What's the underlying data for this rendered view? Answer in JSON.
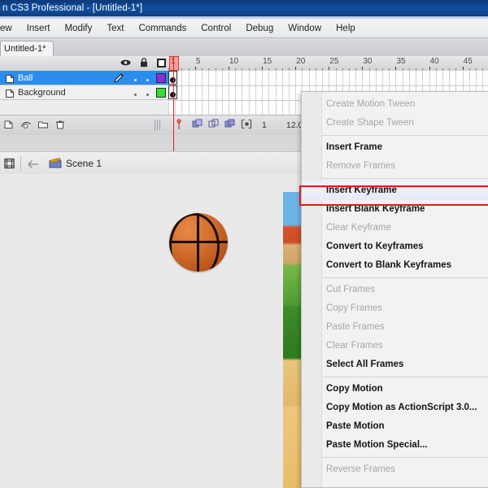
{
  "window": {
    "title": "n CS3 Professional - [Untitled-1*]"
  },
  "menubar": {
    "items": [
      {
        "label": "ew"
      },
      {
        "label": "Insert"
      },
      {
        "label": "Modify"
      },
      {
        "label": "Text"
      },
      {
        "label": "Commands"
      },
      {
        "label": "Control"
      },
      {
        "label": "Debug"
      },
      {
        "label": "Window"
      },
      {
        "label": "Help"
      }
    ]
  },
  "document_tab": {
    "label": "Untitled-1*"
  },
  "timeline": {
    "column_icons": [
      "eye-icon",
      "lock-icon",
      "outline-square-icon"
    ],
    "ruler_ticks": [
      "1",
      "5",
      "10",
      "15",
      "20",
      "25",
      "30",
      "35",
      "40",
      "45"
    ],
    "layers": [
      {
        "name": "Ball",
        "selected": true,
        "status_icon": "pencil-icon",
        "color": "#8a2be2"
      },
      {
        "name": "Background",
        "selected": false,
        "status_icon": "dot-icon",
        "color": "#35e035"
      }
    ],
    "footer": {
      "current_frame": "1",
      "fps": "12.0",
      "buttons": [
        "new-layer-icon",
        "add-motion-guide-icon",
        "new-folder-icon",
        "delete-layer-icon"
      ],
      "onion_buttons": [
        "onion-skin-icon",
        "onion-skin-outlines-icon",
        "edit-multiple-frames-icon",
        "modify-onion-markers-icon"
      ]
    }
  },
  "scenebar": {
    "edit_scene_icon": "edit-scene-icon",
    "back_icon": "back-arrow-icon",
    "scene_icon": "clapperboard-icon",
    "scene_label": "Scene 1"
  },
  "stage": {
    "artwork": "basketball-graphic",
    "background_artwork": "beach-scene-background"
  },
  "context_menu": {
    "highlighted_item": "Insert Keyframe",
    "highlight_color": "#e01b1b",
    "items": [
      {
        "label": "Create Motion Tween",
        "enabled": false,
        "separator_after": false
      },
      {
        "label": "Create Shape Tween",
        "enabled": false,
        "separator_after": true
      },
      {
        "label": "Insert Frame",
        "enabled": true,
        "separator_after": false
      },
      {
        "label": "Remove Frames",
        "enabled": false,
        "separator_after": true
      },
      {
        "label": "Insert Keyframe",
        "enabled": true,
        "separator_after": false
      },
      {
        "label": "Insert Blank Keyframe",
        "enabled": true,
        "separator_after": false
      },
      {
        "label": "Clear Keyframe",
        "enabled": false,
        "separator_after": false
      },
      {
        "label": "Convert to Keyframes",
        "enabled": true,
        "separator_after": false
      },
      {
        "label": "Convert to Blank Keyframes",
        "enabled": true,
        "separator_after": true
      },
      {
        "label": "Cut Frames",
        "enabled": false,
        "separator_after": false
      },
      {
        "label": "Copy Frames",
        "enabled": false,
        "separator_after": false
      },
      {
        "label": "Paste Frames",
        "enabled": false,
        "separator_after": false
      },
      {
        "label": "Clear Frames",
        "enabled": false,
        "separator_after": false
      },
      {
        "label": "Select All Frames",
        "enabled": true,
        "separator_after": true
      },
      {
        "label": "Copy Motion",
        "enabled": true,
        "separator_after": false
      },
      {
        "label": "Copy Motion as ActionScript 3.0...",
        "enabled": true,
        "separator_after": false
      },
      {
        "label": "Paste Motion",
        "enabled": true,
        "separator_after": false
      },
      {
        "label": "Paste Motion Special...",
        "enabled": true,
        "separator_after": true
      },
      {
        "label": "Reverse Frames",
        "enabled": false,
        "separator_after": false
      }
    ]
  }
}
